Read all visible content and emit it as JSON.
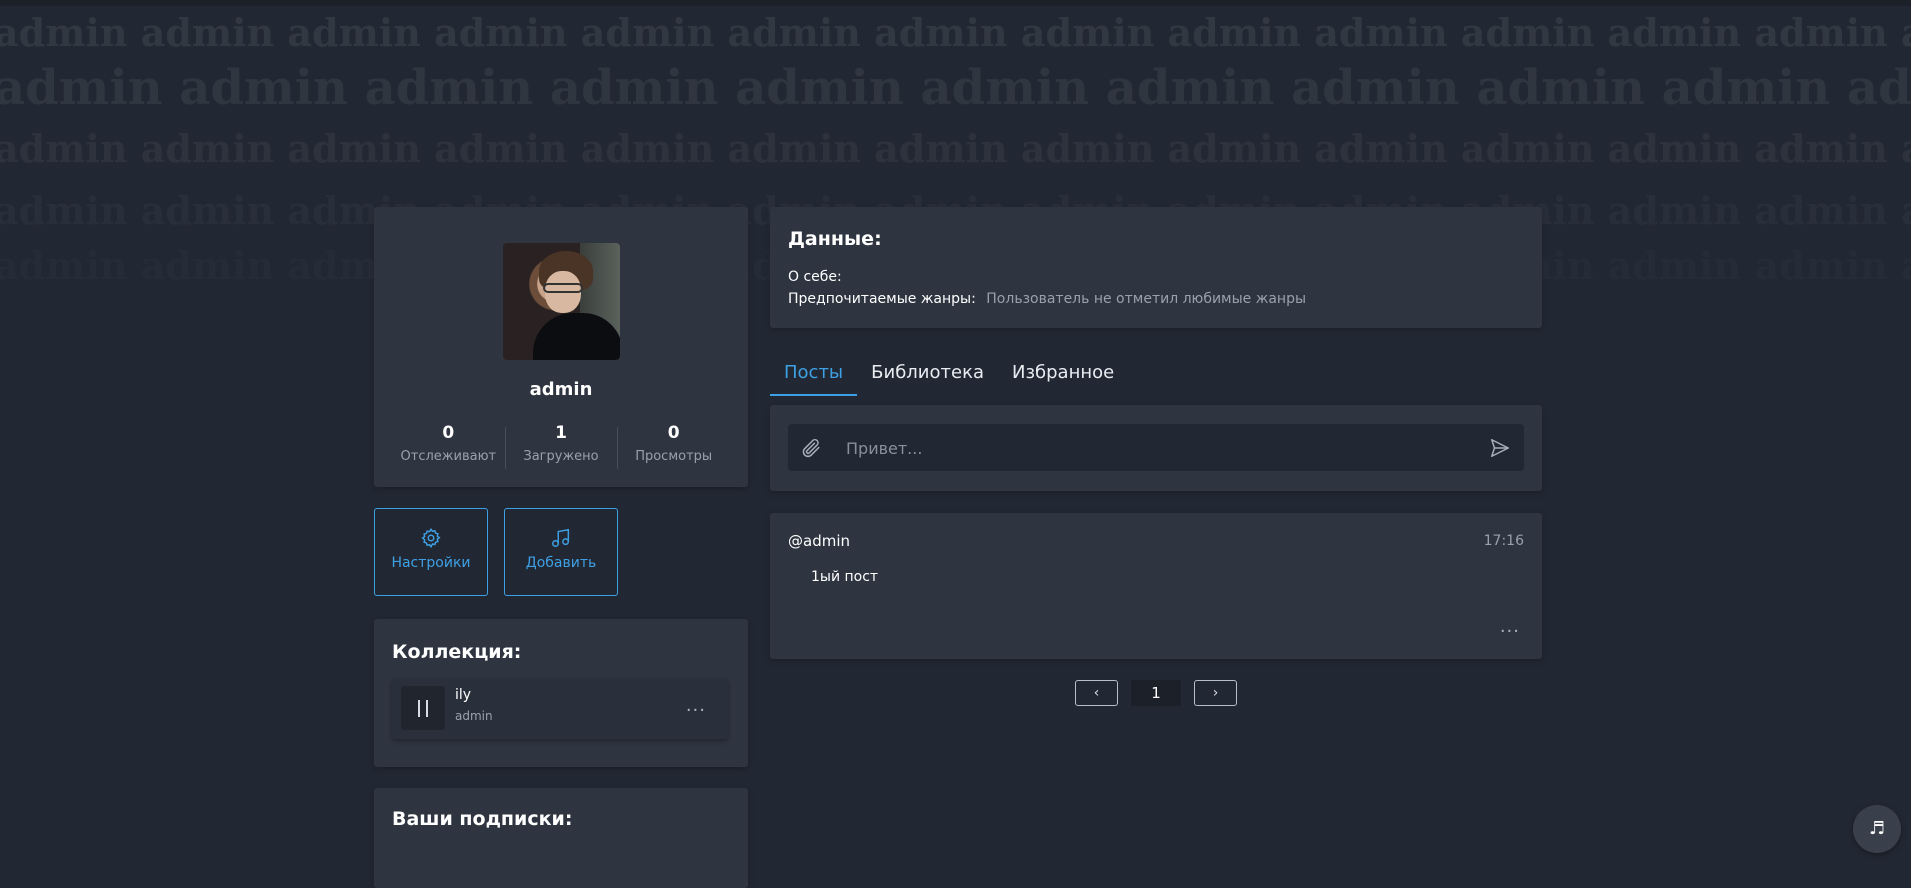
{
  "watermark": {
    "text": "admin admin admin admin admin admin admin admin admin admin admin admin admin admin admin admin admin admin"
  },
  "profile": {
    "username": "admin",
    "stats": [
      {
        "value": "0",
        "label": "Отслеживают"
      },
      {
        "value": "1",
        "label": "Загружено"
      },
      {
        "value": "0",
        "label": "Просмотры"
      }
    ]
  },
  "actions": {
    "settings_label": "Настройки",
    "add_label": "Добавить"
  },
  "collection": {
    "title": "Коллекция:",
    "track": {
      "name": "ily",
      "artist": "admin",
      "more": "..."
    }
  },
  "subscriptions": {
    "title": "Ваши подписки:"
  },
  "info": {
    "title": "Данные:",
    "about_label": "О себе:",
    "genres_label": "Предпочитаемые жанры:",
    "genres_value": "Пользователь не отметил любимые жанры"
  },
  "tabs": [
    {
      "label": "Посты",
      "active": true
    },
    {
      "label": "Библиотека",
      "active": false
    },
    {
      "label": "Избранное",
      "active": false
    }
  ],
  "composer": {
    "placeholder": "Привет..."
  },
  "post": {
    "author": "@admin",
    "time": "17:16",
    "content": "1ый пост",
    "more": "..."
  },
  "pagination": {
    "prev": "‹",
    "current": "1",
    "next": "›"
  },
  "music_fab": "♬",
  "colors": {
    "accent": "#3ea0e4",
    "background": "#222833",
    "card": "#2e3440"
  }
}
